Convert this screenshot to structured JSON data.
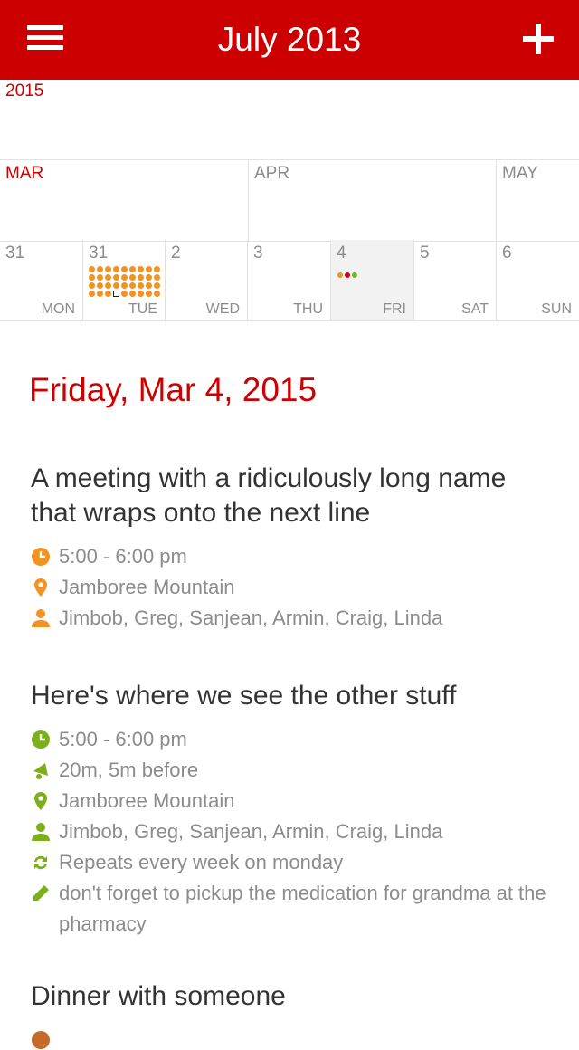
{
  "header": {
    "title": "July 2013"
  },
  "year_label": "2015",
  "months": [
    {
      "label": "MAR",
      "current": true
    },
    {
      "label": "APR",
      "current": false
    },
    {
      "label": "MAY",
      "current": false
    }
  ],
  "week": [
    {
      "num": "31",
      "weekday": "MON"
    },
    {
      "num": "31",
      "weekday": "TUE"
    },
    {
      "num": "2",
      "weekday": "WED"
    },
    {
      "num": "3",
      "weekday": "THU"
    },
    {
      "num": "4",
      "weekday": "FRI"
    },
    {
      "num": "5",
      "weekday": "SAT"
    },
    {
      "num": "6",
      "weekday": "SUN"
    }
  ],
  "colors": {
    "brand": "#cc0000",
    "orange": "#f39121",
    "green": "#7bb01b",
    "red": "#d0021b"
  },
  "selected_date": "Friday, Mar 4, 2015",
  "events": [
    {
      "title": "A meeting with a ridiculously long name that wraps onto the next line",
      "time": "5:00 - 6:00 pm",
      "location": "Jamboree Mountain",
      "attendees": "Jimbob, Greg, Sanjean, Armin, Craig, Linda"
    },
    {
      "title": "Here's where we see the other stuff",
      "time": "5:00 - 6:00 pm",
      "alert": "20m, 5m before",
      "location": "Jamboree Mountain",
      "attendees": "Jimbob, Greg, Sanjean, Armin, Craig, Linda",
      "repeat": "Repeats every week on monday",
      "notes": "don't forget to pickup the medication for grandma at the pharmacy"
    },
    {
      "title": "Dinner with someone"
    }
  ]
}
